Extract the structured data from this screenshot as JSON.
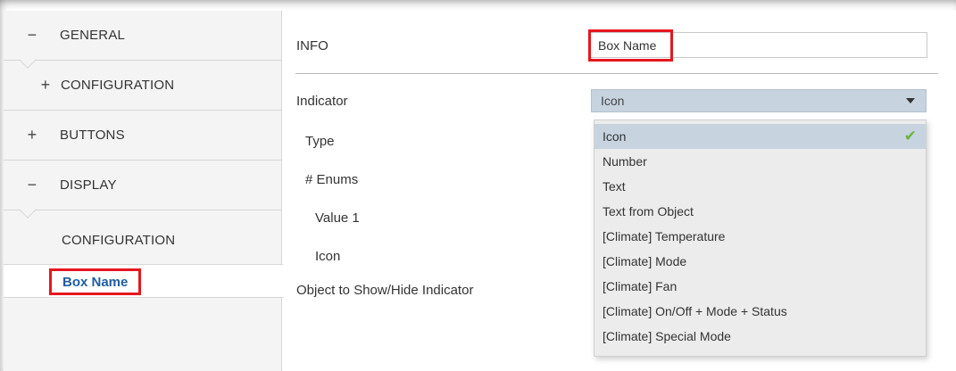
{
  "sidebar": {
    "items": [
      {
        "sign": "−",
        "label": "GENERAL"
      },
      {
        "sign": "+",
        "label": "CONFIGURATION"
      },
      {
        "sign": "+",
        "label": "BUTTONS"
      },
      {
        "sign": "−",
        "label": "DISPLAY"
      },
      {
        "sign": "",
        "label": "CONFIGURATION"
      }
    ],
    "selected": "Box Name"
  },
  "main": {
    "info_label": "INFO",
    "name_value": "Box Name",
    "indicator_label": "Indicator",
    "indicator_value": "Icon",
    "fields": [
      "Type",
      "# Enums",
      "Value 1",
      "Icon"
    ],
    "object_label": "Object to Show/Hide Indicator",
    "dropdown_options": [
      "Icon",
      "Number",
      "Text",
      "Text from Object",
      "[Climate] Temperature",
      "[Climate] Mode",
      "[Climate] Fan",
      "[Climate] On/Off + Mode + Status",
      "[Climate] Special Mode"
    ],
    "check_glyph": "✔"
  },
  "colors": {
    "highlight_red": "#e5171f",
    "selected_blue_text": "#1f5e9e",
    "select_bg": "#c7d4e0",
    "check_green": "#6cb33f"
  }
}
